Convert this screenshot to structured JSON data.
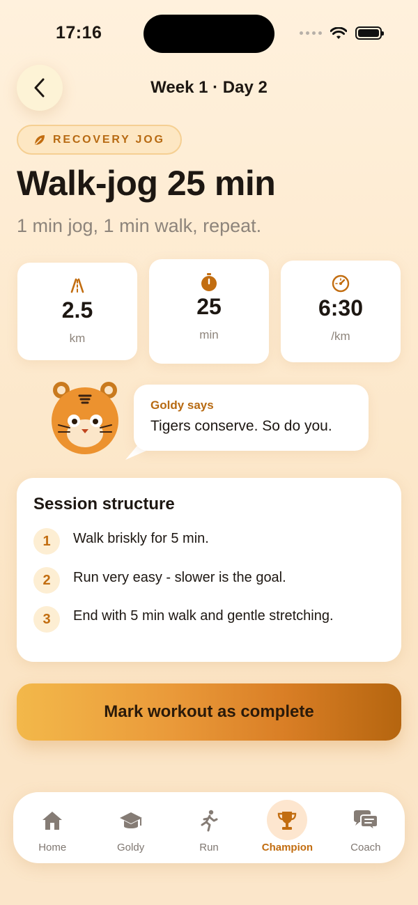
{
  "status_bar": {
    "time": "17:16"
  },
  "header": {
    "title": "Week 1 · Day 2",
    "back_icon": "chevron-left-icon"
  },
  "tag": {
    "label": "RECOVERY JOG",
    "icon": "leaf-icon"
  },
  "workout": {
    "title": "Walk-jog 25 min",
    "subtitle": "1 min jog, 1 min walk, repeat."
  },
  "stats": [
    {
      "icon": "road-icon",
      "value": "2.5",
      "unit": "km"
    },
    {
      "icon": "stopwatch-icon",
      "value": "25",
      "unit": "min"
    },
    {
      "icon": "speedometer-icon",
      "value": "6:30",
      "unit": "/km"
    }
  ],
  "coach_bubble": {
    "label": "Goldy says",
    "text": "Tigers conserve. So do you."
  },
  "session": {
    "title": "Session structure",
    "steps": [
      {
        "num": "1",
        "text": "Walk briskly for 5 min."
      },
      {
        "num": "2",
        "text": "Run very easy - slower is the goal."
      },
      {
        "num": "3",
        "text": "End with 5 min walk and gentle stretching."
      }
    ]
  },
  "cta": {
    "label": "Mark workout as complete"
  },
  "tabbar": {
    "active": "Champion",
    "accent": "#c26d10",
    "items": [
      {
        "label": "Home",
        "icon": "house-icon"
      },
      {
        "label": "Goldy",
        "icon": "graduation-cap-icon"
      },
      {
        "label": "Run",
        "icon": "runner-icon"
      },
      {
        "label": "Champion",
        "icon": "trophy-icon"
      },
      {
        "label": "Coach",
        "icon": "chat-bubbles-icon"
      }
    ]
  }
}
